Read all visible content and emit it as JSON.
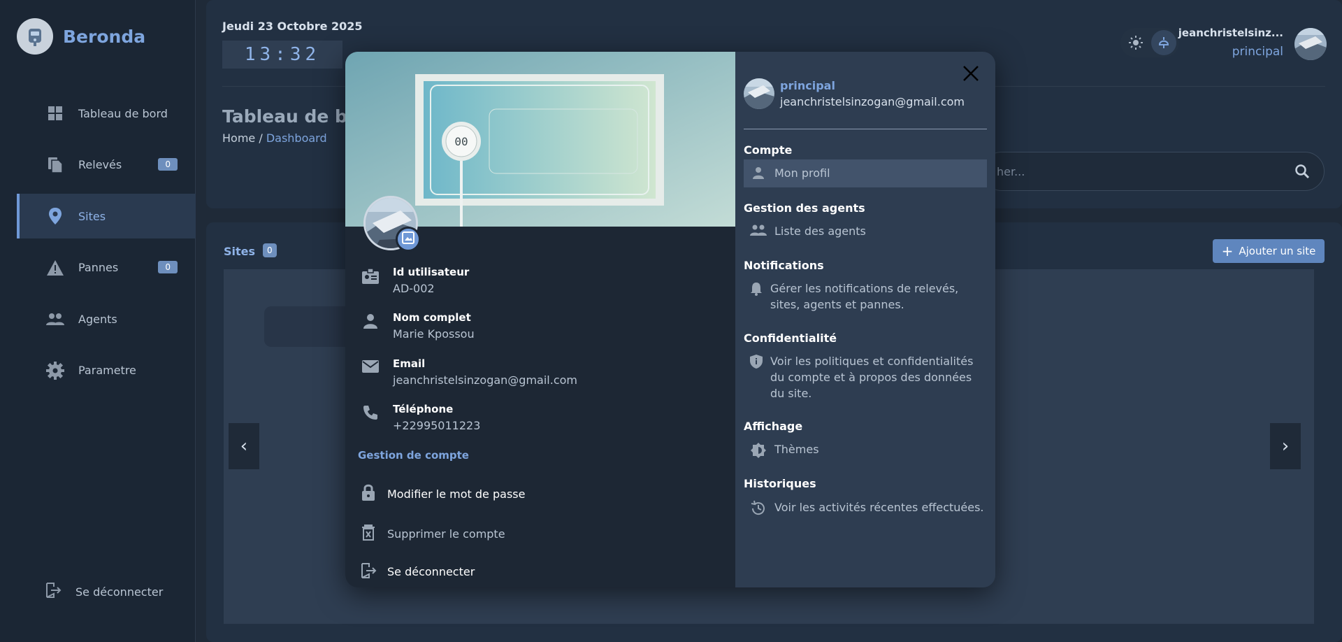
{
  "app": {
    "name": "Beronda"
  },
  "sidebar": {
    "items": [
      {
        "label": "Tableau de bord",
        "icon": "dashboard-icon"
      },
      {
        "label": "Relevés",
        "icon": "document-icon",
        "badge": "0"
      },
      {
        "label": "Sites",
        "icon": "location-icon",
        "active": true
      },
      {
        "label": "Pannes",
        "icon": "warning-icon",
        "badge": "0"
      },
      {
        "label": "Agents",
        "icon": "people-icon"
      },
      {
        "label": "Parametre",
        "icon": "gear-icon"
      }
    ],
    "logout_label": "Se déconnecter"
  },
  "header": {
    "date": "Jeudi 23 Octobre 2025",
    "clock": "13:32",
    "user_name": "jeanchristelsinz...",
    "user_role": "principal"
  },
  "page": {
    "title": "Tableau de bo",
    "breadcrumb_home": "Home",
    "breadcrumb_sep": "/",
    "breadcrumb_current": "Dashboard",
    "search_placeholder": "her..."
  },
  "sites": {
    "label": "Sites",
    "count": "0",
    "add_button": "Ajouter un site",
    "prev": "‹",
    "next": "›"
  },
  "profile_modal": {
    "info": [
      {
        "key": "Id utilisateur",
        "value": "AD-002",
        "icon": "id-badge-icon"
      },
      {
        "key": "Nom complet",
        "value": "Marie Kpossou",
        "icon": "person-icon"
      },
      {
        "key": "Email",
        "value": "jeanchristelsinzogan@gmail.com",
        "icon": "mail-icon"
      },
      {
        "key": "Téléphone",
        "value": "+22995011223",
        "icon": "phone-icon"
      }
    ],
    "account_title": "Gestion de compte",
    "actions": {
      "change_password": "Modifier le mot de passe",
      "delete_account": "Supprimer le compte",
      "logout": "Se déconnecter"
    },
    "right": {
      "role": "principal",
      "email": "jeanchristelsinzogan@gmail.com",
      "sections": {
        "compte": "Compte",
        "mon_profil": "Mon profil",
        "gestion_agents": "Gestion des agents",
        "liste_agents": "Liste des agents",
        "notifications": "Notifications",
        "notifications_desc": "Gérer les notifications de relevés, sites, agents et pannes.",
        "confidentialite": "Confidentialité",
        "confidentialite_desc": "Voir les politiques et confidentialités du compte et à propos des données du site.",
        "affichage": "Affichage",
        "themes": "Thèmes",
        "historiques": "Historiques",
        "historiques_desc": "Voir les activités récentes effectuées."
      }
    }
  }
}
